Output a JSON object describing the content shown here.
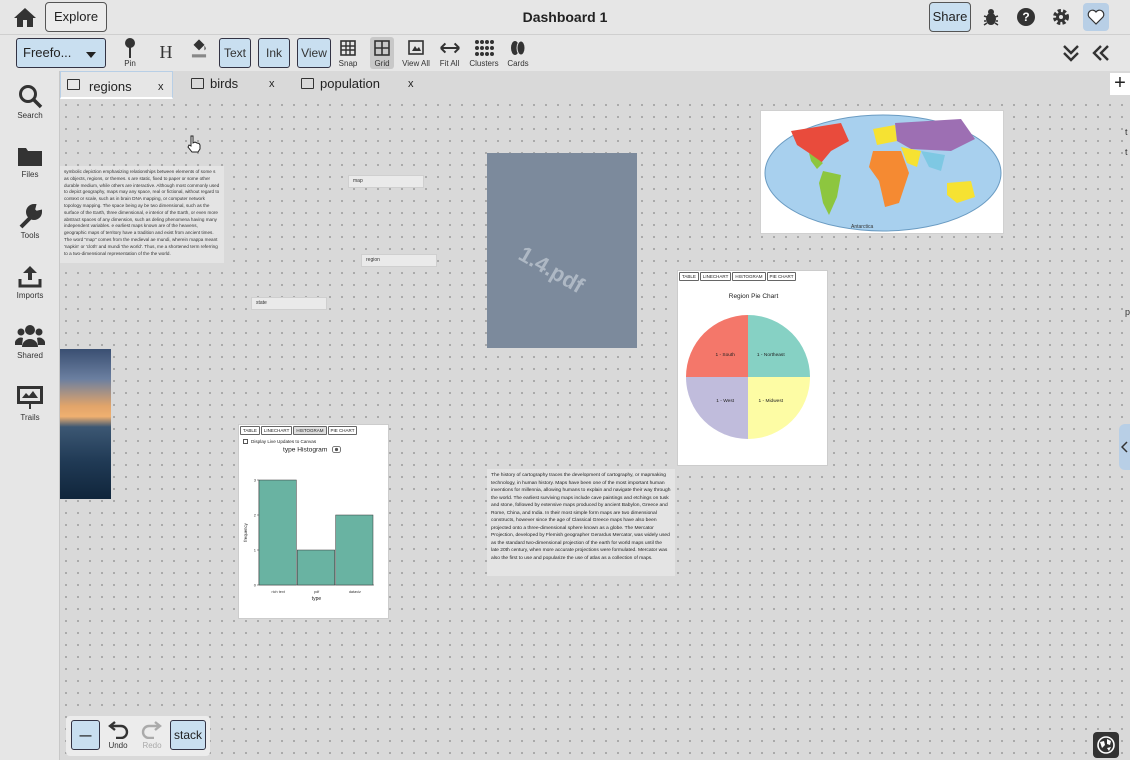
{
  "topbar": {
    "title": "Dashboard 1",
    "explore_label": "Explore",
    "share_label": "Share",
    "icons": [
      "home-icon",
      "bug-icon",
      "help-icon",
      "gear-icon",
      "heart-icon"
    ]
  },
  "toolbar": {
    "mode_value": "Freefo...",
    "pin_label": "Pin",
    "header_glyph": "H",
    "text_label": "Text",
    "ink_label": "Ink",
    "view_label": "View",
    "snap_label": "Snap",
    "grid_label": "Grid",
    "view_all_label": "View All",
    "fit_all_label": "Fit All",
    "clusters_label": "Clusters",
    "cards_label": "Cards"
  },
  "sidebar": {
    "items": [
      {
        "label": "Search",
        "icon": "search-icon"
      },
      {
        "label": "Files",
        "icon": "folder-icon"
      },
      {
        "label": "Tools",
        "icon": "wrench-icon"
      },
      {
        "label": "Imports",
        "icon": "upload-icon"
      },
      {
        "label": "Shared",
        "icon": "users-icon"
      },
      {
        "label": "Trails",
        "icon": "presentation-icon"
      }
    ]
  },
  "tabs": [
    {
      "label": "regions",
      "close": "x"
    },
    {
      "label": "birds",
      "close": "x"
    },
    {
      "label": "population",
      "close": "x"
    }
  ],
  "add_tab_label": "+",
  "canvas": {
    "wiki_text": "symbolic depiction emphasizing relationships between elements of some s as objects, regions, or themes. s are static, fixed to paper or some other durable medium, while others are interactive. Although most commonly used to depict geography, maps may any space, real or fictional, without regard to context or scale, such as in brain DNA mapping, or computer network topology mapping. The space being ay be two dimensional, such as the surface of the Earth, three dimensional, e interior of the Earth, or even more abstract spaces of any dimension, such as deling phenomena having many independent variables. e earliest maps known are of the heavens, geographic maps of territory have a tradition and exist from ancient times. The word \"map\" comes from the medieval ae mundi, wherein mappa meant 'napkin' or 'cloth' and mundi 'the world'. Thus, me a shortened term referring to a two-dimensional representation of the the world.",
    "labels": {
      "map": "map",
      "region": "region",
      "state": "state"
    },
    "pdf_name": "1.4.pdf",
    "cartography_text": "The history of cartography traces the development of cartography, or mapmaking technology, in human history. Maps have been one of the most important human inventions for millennia, allowing humans to explain and navigate their way through the world. The earliest surviving maps include cave paintings and etchings on tusk and stone, followed by extensive maps produced by ancient Babylon, Greece and Rome, China, and India. In their most simple form maps are two dimensional constructs, however since the age of Classical Greece maps have also been projected onto a three-dimensional sphere known as a globe. The Mercator Projection, developed by Flemish geographer Gerardus Mercator, was widely used as the standard two-dimensional projection of the earth for world maps until the late 20th century, when more accurate projections were formulated. Mercator was also the first to use and popularize the use of atlas as a collection of maps.",
    "chart_tabs": [
      "TABLE",
      "LINECHART",
      "HISTOGRAM",
      "PIE CHART"
    ],
    "hist_checkbox_label": "Display Live Updates to Canvas"
  },
  "chart_data": [
    {
      "type": "pie",
      "title": "Region Pie Chart",
      "categories": [
        "1 - South",
        "1 - Northeast",
        "1 - Midwest",
        "1 - West"
      ],
      "values": [
        1,
        1,
        1,
        1
      ],
      "colors": [
        "#f4776a",
        "#86d1c4",
        "#fdfca4",
        "#c0bcdc"
      ]
    },
    {
      "type": "bar",
      "title": "type Histogram",
      "xlabel": "type",
      "ylabel": "frequency",
      "categories": [
        "rich text",
        "pdf",
        "dataviz"
      ],
      "values": [
        3,
        1,
        2
      ],
      "ylim": [
        0,
        3
      ],
      "yticks": [
        "0",
        "1",
        "2",
        "3"
      ],
      "color": "#69b3a2"
    }
  ],
  "bottom": {
    "minus_label": "—",
    "undo_label": "Undo",
    "redo_label": "Redo",
    "stack_label": "stack"
  },
  "right_edge_chars": [
    "t",
    "t",
    "p"
  ]
}
